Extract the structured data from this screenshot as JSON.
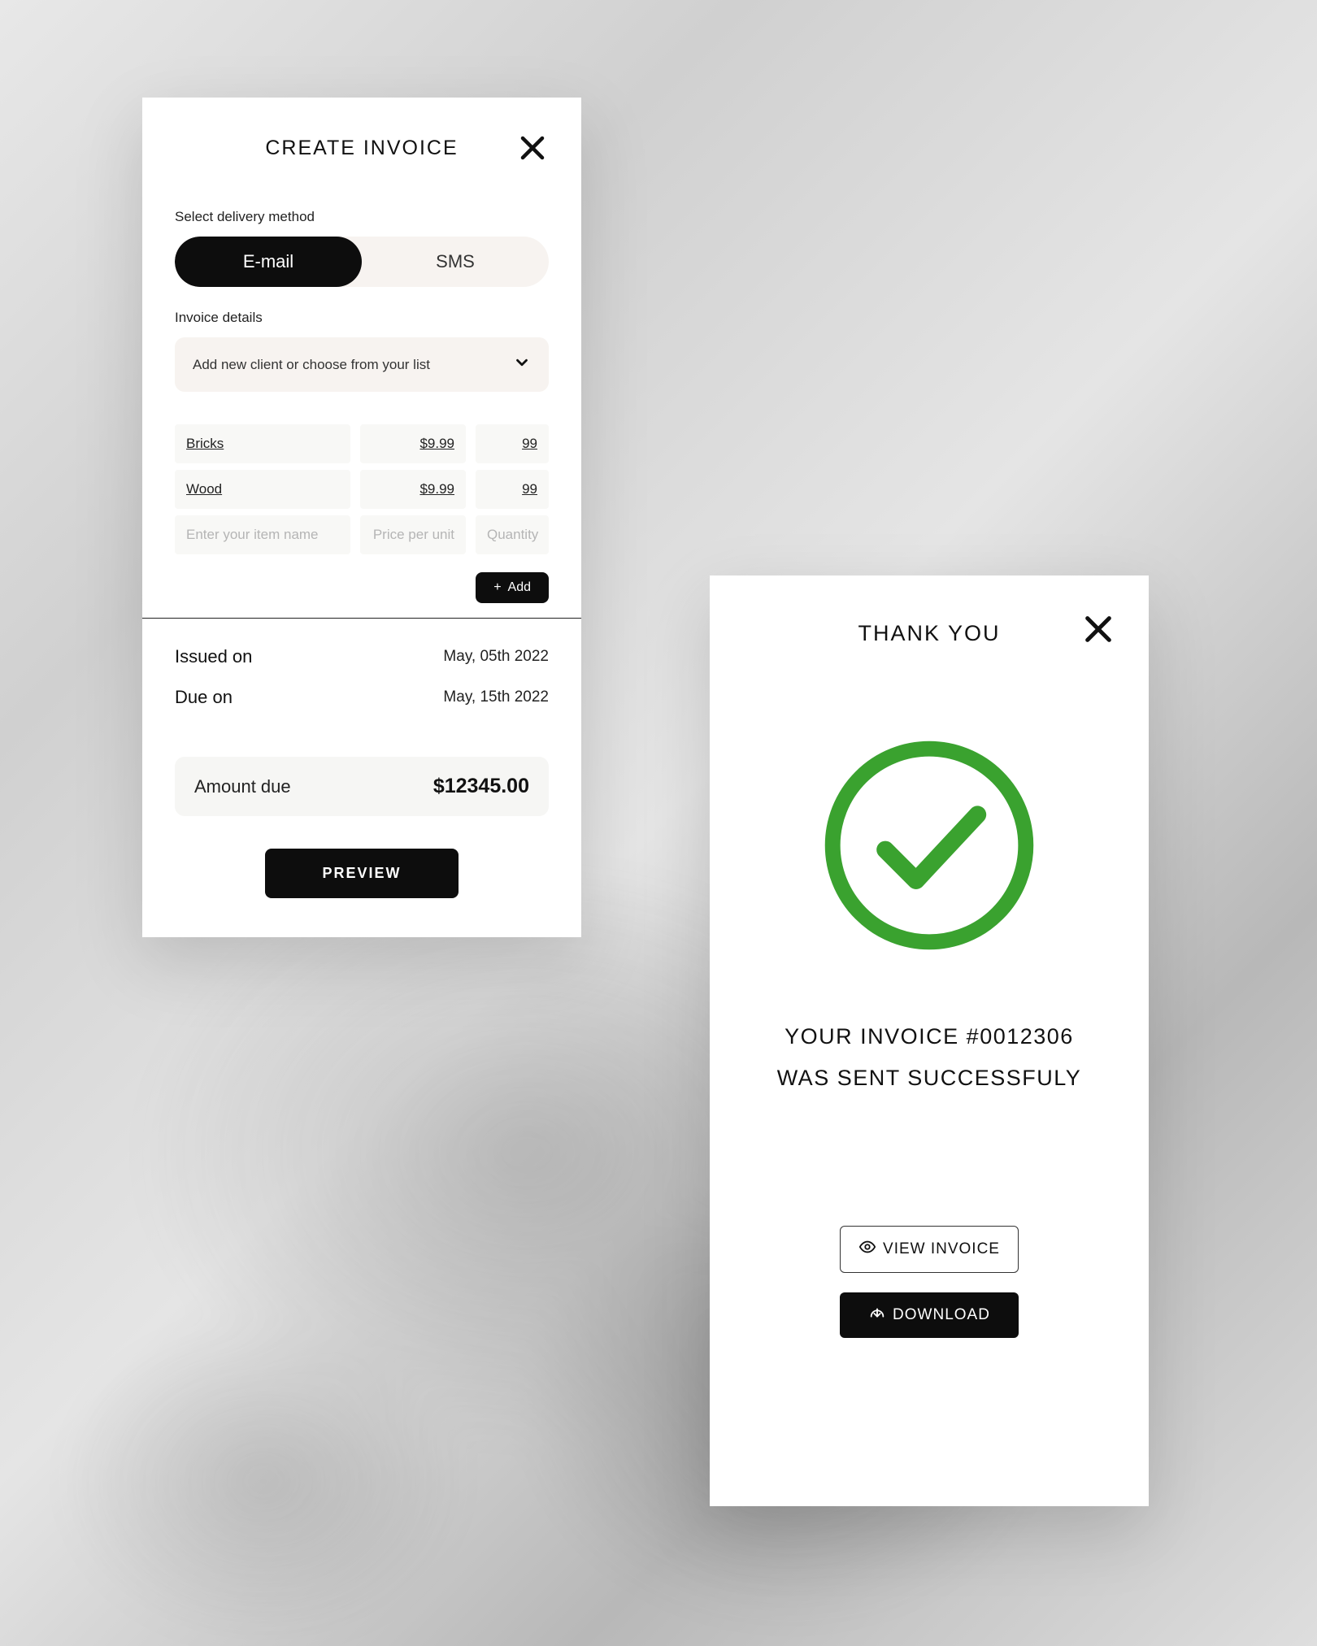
{
  "create": {
    "title": "CREATE INVOICE",
    "delivery_label": "Select delivery method",
    "options": {
      "email": "E-mail",
      "sms": "SMS"
    },
    "details_label": "Invoice details",
    "client_placeholder": "Add new client or choose from your list",
    "items": [
      {
        "name": "Bricks",
        "price": "$9.99",
        "qty": "99"
      },
      {
        "name": "Wood",
        "price": "$9.99",
        "qty": "99"
      }
    ],
    "item_placeholders": {
      "name": "Enter your item name",
      "price": "Price per unit",
      "qty": "Quantity"
    },
    "add_label": "Add",
    "issued_label": "Issued on",
    "issued_value": "May, 05th 2022",
    "due_label": "Due on",
    "due_value": "May, 15th 2022",
    "amount_label": "Amount due",
    "amount_value": "$12345.00",
    "preview_label": "PREVIEW"
  },
  "thankyou": {
    "title": "THANK YOU",
    "line1": "YOUR INVOICE #0012306",
    "line2": "WAS SENT SUCCESSFULY",
    "view_label": "VIEW INVOICE",
    "download_label": "DOWNLOAD",
    "accent_color": "#3aa22f"
  }
}
